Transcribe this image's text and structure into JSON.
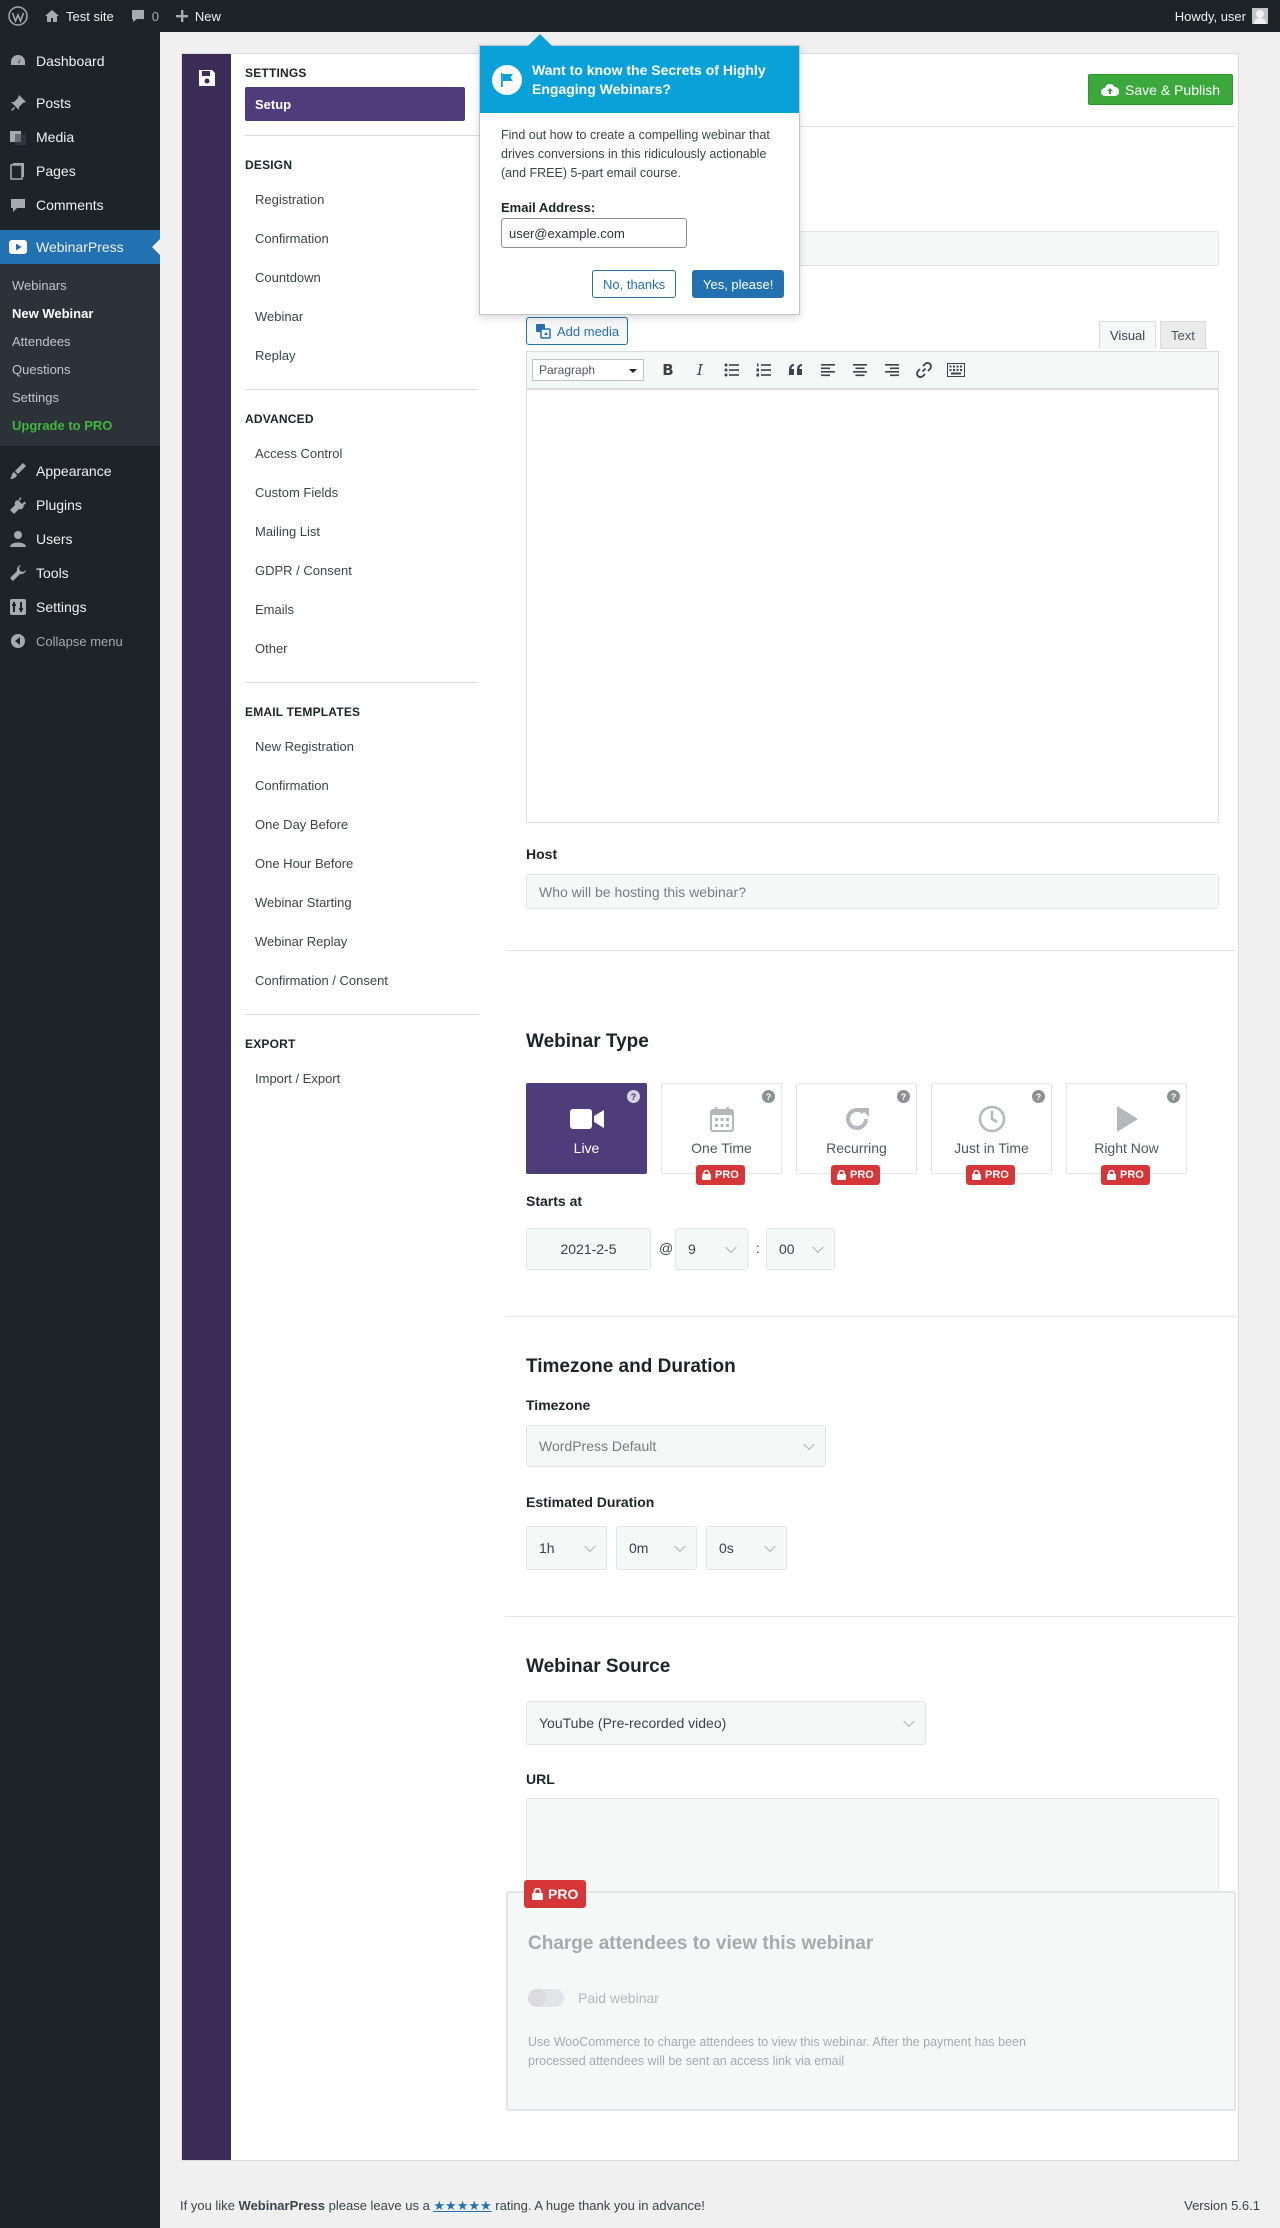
{
  "adminbar": {
    "site_name": "Test site",
    "comments_count": "0",
    "new_label": "New",
    "howdy": "Howdy, user"
  },
  "menu": {
    "dashboard": "Dashboard",
    "posts": "Posts",
    "media": "Media",
    "pages": "Pages",
    "comments": "Comments",
    "webinarpress": "WebinarPress",
    "submenu": [
      "Webinars",
      "New Webinar",
      "Attendees",
      "Questions",
      "Settings",
      "Upgrade to PRO"
    ],
    "appearance": "Appearance",
    "plugins": "Plugins",
    "users": "Users",
    "tools": "Tools",
    "settings": "Settings",
    "collapse": "Collapse menu"
  },
  "nav": {
    "settings_heading": "SETTINGS",
    "setup": "Setup",
    "design_heading": "DESIGN",
    "design": [
      "Registration",
      "Confirmation",
      "Countdown",
      "Webinar",
      "Replay"
    ],
    "advanced_heading": "ADVANCED",
    "advanced": [
      "Access Control",
      "Custom Fields",
      "Mailing List",
      "GDPR / Consent",
      "Emails",
      "Other"
    ],
    "email_heading": "EMAIL TEMPLATES",
    "email": [
      "New Registration",
      "Confirmation",
      "One Day Before",
      "One Hour Before",
      "Webinar Starting",
      "Webinar Replay",
      "Confirmation / Consent"
    ],
    "export_heading": "EXPORT",
    "export": [
      "Import / Export"
    ]
  },
  "content": {
    "save_publish": "Save & Publish",
    "add_media": "Add media",
    "tab_visual": "Visual",
    "tab_text": "Text",
    "format_select": "Paragraph",
    "host_label": "Host",
    "host_placeholder": "Who will be hosting this webinar?",
    "type_heading": "Webinar Type",
    "types": [
      {
        "label": "Live",
        "icon": "video-camera-icon",
        "pro": false,
        "selected": true
      },
      {
        "label": "One Time",
        "icon": "calendar-icon",
        "pro": true,
        "selected": false
      },
      {
        "label": "Recurring",
        "icon": "repeat-icon",
        "pro": true,
        "selected": false
      },
      {
        "label": "Just in Time",
        "icon": "clock-icon",
        "pro": true,
        "selected": false
      },
      {
        "label": "Right Now",
        "icon": "play-icon",
        "pro": true,
        "selected": false
      }
    ],
    "help_mark": "?",
    "pro_label": "PRO",
    "starts_label": "Starts at",
    "start_date": "2021-2-5",
    "at_sign": "@",
    "start_hour": "9",
    "colon": ":",
    "start_minute": "00",
    "tz_heading": "Timezone and Duration",
    "tz_label": "Timezone",
    "tz_value": "WordPress Default",
    "duration_label": "Estimated Duration",
    "duration_h": "1h",
    "duration_m": "0m",
    "duration_s": "0s",
    "source_heading": "Webinar Source",
    "source_value": "YouTube (Pre-recorded video)",
    "url_label": "URL",
    "charge_heading": "Charge attendees to view this webinar",
    "paid_label": "Paid webinar",
    "charge_desc": "Use WooCommerce to charge attendees to view this webinar. After the payment has been processed attendees will be sent an access link via email"
  },
  "popup": {
    "title": "Want to know the Secrets of Highly Engaging Webinars?",
    "body": "Find out how to create a compelling webinar that drives conversions in this ridiculously actionable (and FREE) 5-part email course.",
    "email_label": "Email Address:",
    "email_value": "user@example.com",
    "btn_no": "No, thanks",
    "btn_yes": "Yes, please!"
  },
  "footer": {
    "text_before": "If you like ",
    "brand": "WebinarPress",
    "text_mid": " please leave us a ",
    "stars": "★★★★★",
    "text_after": " rating. A huge thank you in advance!",
    "version": "Version 5.6.1"
  },
  "colors": {
    "admin_dark": "#1d2327",
    "accent_blue": "#2271b1",
    "purple": "#4e3d7a",
    "rail_purple": "#3b2d58",
    "publish_green": "#3aa83a",
    "pro_red": "#d63638",
    "popup_blue": "#0aa1d8"
  }
}
